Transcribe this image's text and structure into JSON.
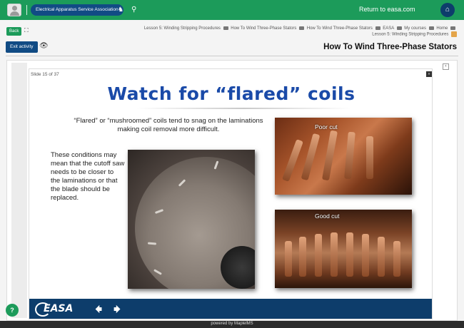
{
  "topbar": {
    "return_label": "Return to easa.com",
    "org_label": "Electrical Apparatus Service Association"
  },
  "toolbar": {
    "back_label": "Back",
    "exit_label": "Exit activity"
  },
  "breadcrumb": {
    "line1": [
      "Home",
      "My courses",
      "EASA",
      "How To Wind Three-Phase Stators",
      "How To Wind Three-Phase Stators",
      "Lesson 5: Winding Stripping Procedures"
    ],
    "line2": "Lesson 5: Winding Stripping Procedures"
  },
  "page_title": "How To Wind Three-Phase Stators",
  "slide": {
    "counter": "Slide 15 of 37",
    "title": "Watch for “flared” coils",
    "bullet1": "“Flared” or “mushroomed” coils tend to snag on the laminations making coil removal more difficult.",
    "bullet2": "These conditions may mean that the cutoff saw needs to be closer to the laminations or that the blade should be replaced.",
    "poor_label": "Poor cut",
    "good_label": "Good cut",
    "logo_text": "EASA"
  },
  "footer": {
    "powered": "powered by MaplelMS",
    "help": "?"
  }
}
